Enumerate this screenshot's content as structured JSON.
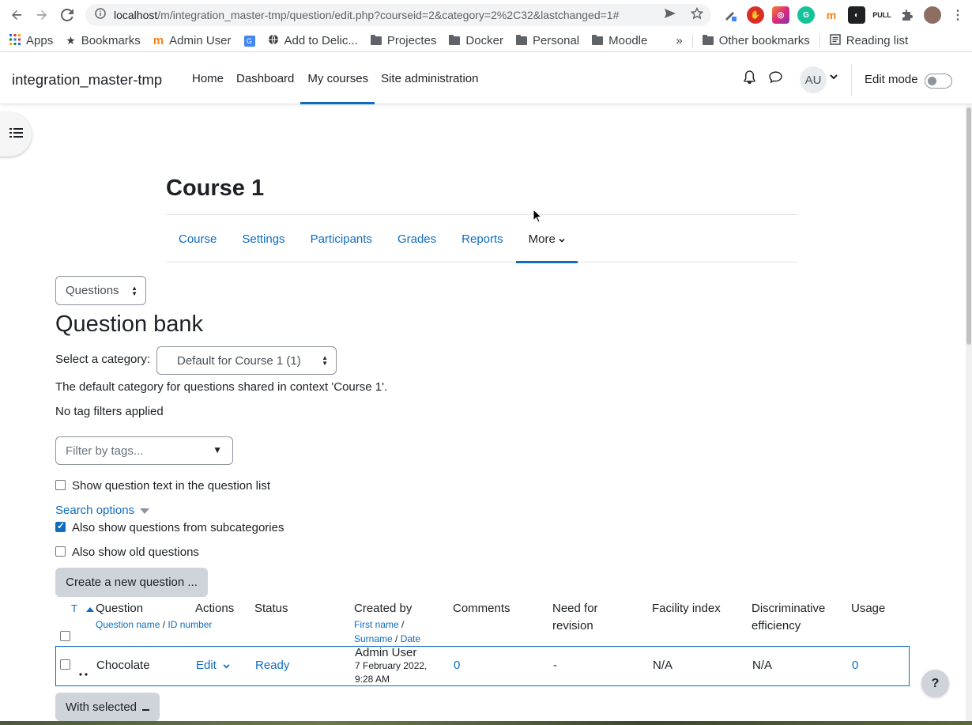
{
  "browser": {
    "url_host": "localhost",
    "url_path": "/m/integration_master-tmp/question/edit.php?courseid=2&category=2%2C32&lastchanged=1#",
    "bookmarks": [
      "Apps",
      "Bookmarks",
      "Admin User",
      "Add to Delic...",
      "Projectes",
      "Docker",
      "Personal",
      "Moodle"
    ],
    "overflow": "»",
    "other_bookmarks": "Other bookmarks",
    "reading_list": "Reading list"
  },
  "navbar": {
    "site_name": "integration_master-tmp",
    "items": [
      "Home",
      "Dashboard",
      "My courses",
      "Site administration"
    ],
    "active_item": "My courses",
    "avatar_initials": "AU",
    "edit_mode_label": "Edit mode"
  },
  "course": {
    "title": "Course 1",
    "tabs": [
      "Course",
      "Settings",
      "Participants",
      "Grades",
      "Reports",
      "More"
    ],
    "active_tab": "More"
  },
  "page": {
    "nav_select": "Questions",
    "heading": "Question bank",
    "category_label": "Select a category:",
    "category_value": "Default for Course 1 (1)",
    "category_description": "The default category for questions shared in context 'Course 1'.",
    "tag_status": "No tag filters applied",
    "tag_placeholder": "Filter by tags...",
    "show_question_text": "Show question text in the question list",
    "search_options": "Search options",
    "subcategories": "Also show questions from subcategories",
    "old_questions": "Also show old questions",
    "create_button": "Create a new question ...",
    "with_selected": "With selected"
  },
  "table": {
    "type_col": "T",
    "headers": {
      "question": "Question",
      "question_sub_name": "Question name",
      "question_sub_sep": " / ",
      "question_sub_id": "ID number",
      "actions": "Actions",
      "status": "Status",
      "created_by": "Created by",
      "created_sub_first": "First name",
      "created_sub_surname": "Surname",
      "created_sub_date": "Date",
      "slash": " /",
      "comments": "Comments",
      "need_revision": "Need for revision",
      "facility": "Facility index",
      "discriminative": "Discriminative efficiency",
      "usage": "Usage"
    },
    "rows": [
      {
        "name": "Chocolate",
        "action": "Edit",
        "status": "Ready",
        "creator": "Admin User",
        "date_line1": "7 February 2022,",
        "date_line2": "9:28 AM",
        "comments": "0",
        "need_revision": "-",
        "facility": "N/A",
        "discriminative": "N/A",
        "usage": "0"
      }
    ]
  },
  "help": "?"
}
